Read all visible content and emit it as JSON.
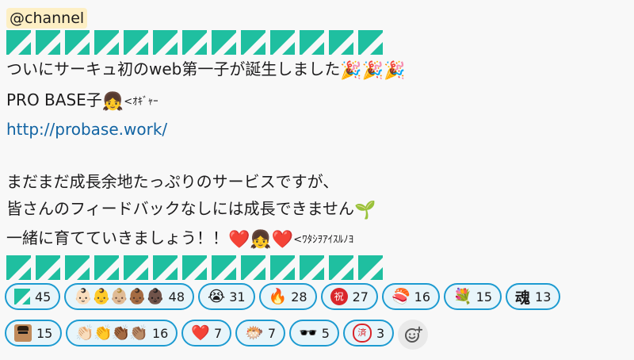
{
  "message": {
    "mention": "@channel",
    "tile_count": 13,
    "line1": {
      "text": "ついにサーキュ初のweb第一子が誕生しました",
      "emoji": "🎉🎉🎉"
    },
    "line2": {
      "text": "PRO BASE子",
      "emoji": "👧",
      "small": "<ｵｷﾞｬｰ"
    },
    "link": "http://probase.work/",
    "line3": "まだまだ成長余地たっぷりのサービスですが、",
    "line4": {
      "text": "皆さんのフィードバックなしには成長できません",
      "emoji": "🌱"
    },
    "line5": {
      "text": "一緒に育てていきましょう！！",
      "emoji": "❤️👧❤️",
      "small": "<ﾜﾀｼｦｱｲｽﾙﾉﾖ"
    }
  },
  "colors": {
    "tile": "#1fbfa0",
    "tile_cut": "#f8f8f8",
    "accent": "#1d9bd1",
    "pill_bg": "#e8f5fa"
  },
  "reactions": {
    "row1": [
      {
        "icon": "tile-icon",
        "count": "45"
      },
      {
        "icon": "👶🏻👶👶🏼👶🏾👶🏿",
        "count": "48"
      },
      {
        "icon": "😭",
        "count": "31"
      },
      {
        "icon": "🔥",
        "count": "28"
      },
      {
        "icon": "祝",
        "count": "27"
      },
      {
        "icon": "🍣",
        "count": "16"
      },
      {
        "icon": "💐",
        "count": "15"
      },
      {
        "icon": "魂",
        "count": "13"
      }
    ],
    "row2": [
      {
        "icon": "avatar-image",
        "count": "15"
      },
      {
        "icon": "👏🏻👏👏🏾👏🏽",
        "count": "16"
      },
      {
        "icon": "❤️",
        "count": "7"
      },
      {
        "icon": "🐡",
        "count": "7"
      },
      {
        "icon": "🕶️",
        "count": "5"
      },
      {
        "icon": "済",
        "count": "3"
      }
    ],
    "add_icon": "add-reaction-icon"
  }
}
